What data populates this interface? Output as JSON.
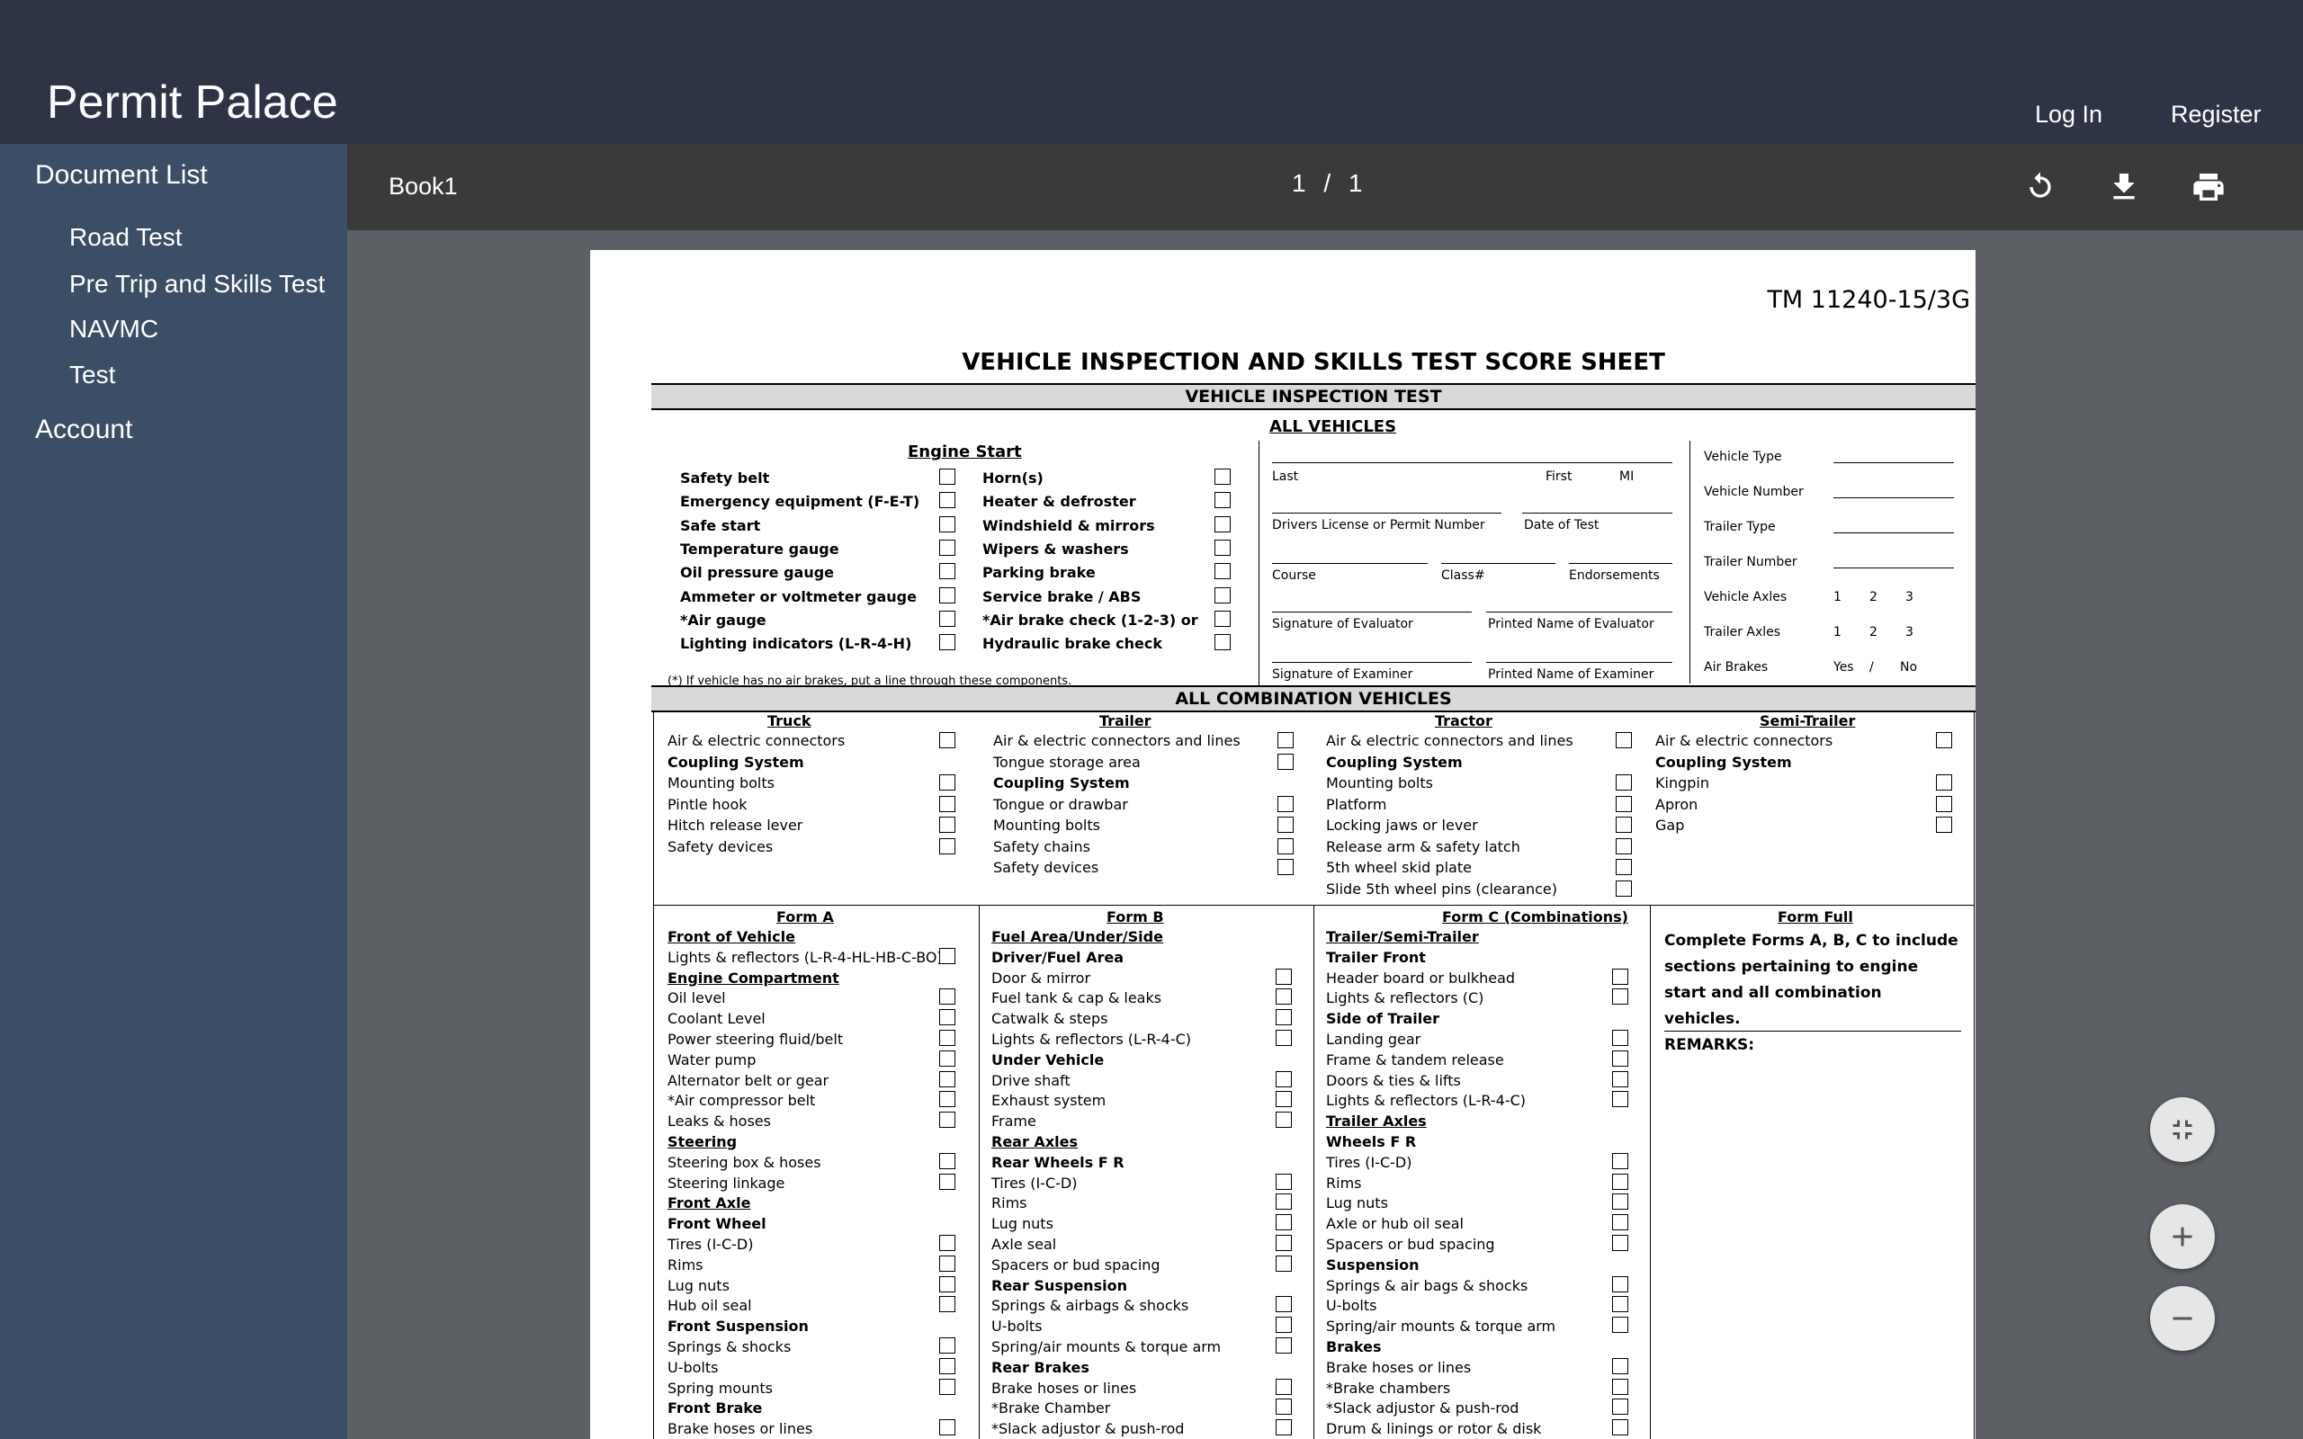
{
  "app": {
    "brand": "Permit Palace",
    "login": "Log In",
    "register": "Register"
  },
  "sidebar": {
    "document_list": "Document List",
    "items": [
      "Road Test",
      "Pre Trip and Skills Test",
      "NAVMC",
      "Test"
    ],
    "account": "Account"
  },
  "viewer": {
    "title": "Book1",
    "page_current": "1",
    "page_sep": "/",
    "page_total": "1",
    "icons": [
      "rotate-icon",
      "download-icon",
      "print-icon"
    ],
    "fab_icons": [
      "fit-page-icon",
      "zoom-in-icon",
      "zoom-out-icon"
    ]
  },
  "doc": {
    "code": "TM 11240-15/3G",
    "title": "VEHICLE INSPECTION AND SKILLS TEST SCORE SHEET",
    "vehicle_inspection_test": "VEHICLE INSPECTION TEST",
    "all_vehicles": "ALL VEHICLES",
    "engine_start": "Engine Start",
    "engine_left": [
      "Safety belt",
      "Emergency equipment (F-E-T)",
      "Safe start",
      "Temperature gauge",
      "Oil pressure gauge",
      "Ammeter or voltmeter gauge",
      "*Air gauge",
      "Lighting indicators (L-R-4-H)"
    ],
    "engine_right": [
      "Horn(s)",
      "Heater & defroster",
      "Windshield & mirrors",
      "Wipers & washers",
      "Parking brake",
      "Service brake / ABS",
      "*Air brake check (1-2-3) or",
      "Hydraulic brake check"
    ],
    "footnote": "(*) If vehicle has no air brakes, put a line through these components.",
    "fields": {
      "last": "Last",
      "first": "First",
      "mi": "MI",
      "license": "Drivers License or Permit Number",
      "date_of_test": "Date of Test",
      "course": "Course",
      "class": "Class#",
      "endorsements": "Endorsements",
      "sig_evaluator": "Signature of Evaluator",
      "name_evaluator": "Printed Name of Evaluator",
      "sig_examiner": "Signature of Examiner",
      "name_examiner": "Printed Name of Examiner"
    },
    "vehicle_fields": {
      "type": "Vehicle Type",
      "number": "Vehicle Number",
      "trailer_type": "Trailer Type",
      "trailer_number": "Trailer Number",
      "axles": "Vehicle Axles",
      "trailer_axles": "Trailer Axles",
      "air_brakes": "Air Brakes",
      "one": "1",
      "two": "2",
      "three": "3",
      "yes": "Yes",
      "slash": "/",
      "no": "No"
    },
    "all_combination": "ALL COMBINATION VEHICLES",
    "combo": {
      "truck": {
        "title": "Truck",
        "rows": [
          "Air & electric connectors",
          "Coupling System",
          "Mounting bolts",
          "Pintle hook",
          "Hitch release lever",
          "Safety devices"
        ]
      },
      "trailer": {
        "title": "Trailer",
        "rows": [
          "Air & electric connectors and lines",
          "Tongue storage area",
          "Coupling System",
          "Tongue or drawbar",
          "Mounting bolts",
          "Safety chains",
          "Safety devices"
        ]
      },
      "tractor": {
        "title": "Tractor",
        "rows": [
          "Air & electric connectors and lines",
          "Coupling System",
          "Mounting bolts",
          "Platform",
          "Locking jaws or lever",
          "Release arm & safety latch",
          "5th wheel skid plate",
          "Slide 5th wheel pins (clearance)"
        ]
      },
      "semi": {
        "title": "Semi-Trailer",
        "rows": [
          "Air & electric connectors",
          "Coupling System",
          "Kingpin",
          "Apron",
          "Gap"
        ]
      }
    },
    "forms": {
      "a": {
        "title": "Form A",
        "rows": [
          "Front of Vehicle",
          "Lights & reflectors (L-R-4-HL-HB-C-BO)",
          "Engine Compartment",
          "Oil level",
          "Coolant Level",
          "Power steering fluid/belt",
          "Water pump",
          "Alternator belt or gear",
          "*Air compressor belt",
          "Leaks & hoses",
          "Steering",
          "Steering box & hoses",
          "Steering linkage",
          "Front Axle",
          "Front Wheel",
          "Tires (I-C-D)",
          "Rims",
          "Lug nuts",
          "Hub oil seal",
          "Front Suspension",
          "Springs & shocks",
          "U-bolts",
          "Spring mounts",
          "Front Brake",
          "Brake hoses or lines"
        ]
      },
      "b": {
        "title": "Form B",
        "rows": [
          "Fuel Area/Under/Side",
          "Driver/Fuel Area",
          "Door & mirror",
          "Fuel tank & cap & leaks",
          "Catwalk & steps",
          "Lights & reflectors (L-R-4-C)",
          "Under Vehicle",
          "Drive shaft",
          "Exhaust system",
          "Frame",
          "Rear Axles",
          "Rear Wheels     F   R",
          "Tires (I-C-D)",
          "Rims",
          "Lug nuts",
          "Axle seal",
          "Spacers or bud spacing",
          "Rear Suspension",
          "Springs & airbags & shocks",
          "U-bolts",
          "Spring/air mounts & torque arm",
          "Rear Brakes",
          "Brake hoses or lines",
          "*Brake Chamber",
          "*Slack adjustor & push-rod"
        ]
      },
      "c": {
        "title": "Form C (Combinations)",
        "rows": [
          "Trailer/Semi-Trailer",
          "Trailer Front",
          "Header board or bulkhead",
          "Lights & reflectors (C)",
          "Side of Trailer",
          "Landing gear",
          "Frame & tandem release",
          "Doors & ties & lifts",
          "Lights & reflectors (L-R-4-C)",
          "Trailer Axles",
          "Wheels          F   R",
          "Tires (I-C-D)",
          "Rims",
          "Lug nuts",
          "Axle or hub oil seal",
          "Spacers or bud spacing",
          "Suspension",
          "Springs & air bags & shocks",
          "U-bolts",
          "Spring/air mounts & torque arm",
          "Brakes",
          "Brake hoses or lines",
          "*Brake chambers",
          "*Slack adjustor & push-rod",
          "Drum & linings or rotor & disk"
        ]
      },
      "full": {
        "title": "Form Full",
        "text": "Complete Forms A, B, C to include sections pertaining to engine start and all combination vehicles.",
        "remarks": "REMARKS:"
      }
    }
  }
}
